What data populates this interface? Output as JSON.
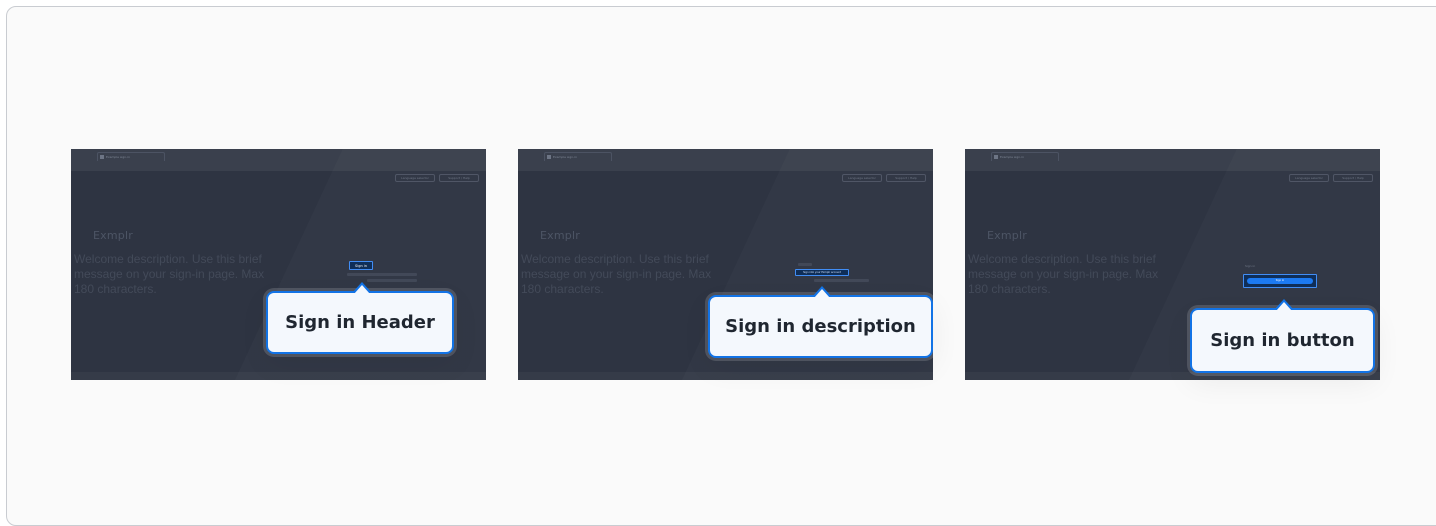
{
  "browser": {
    "tab_title": "Example sign-in"
  },
  "page": {
    "top_buttons": [
      "Language selector",
      "Support / Help"
    ],
    "logo_text": "Exmplr",
    "welcome_text": "Welcome description. Use this brief message on your sign-in page. Max 180 characters."
  },
  "panels": [
    {
      "highlight_text": "Sign in",
      "callout_label": "Sign in Header"
    },
    {
      "highlight_text": "Sign into your Exmplr account",
      "callout_label": "Sign in description"
    },
    {
      "small_label": "Sign in",
      "highlight_text": "Sign in",
      "callout_label": "Sign in button"
    }
  ],
  "colors": {
    "accent": "#1273e6",
    "panel_bg": "#2e3442",
    "callout_bg": "#f4f8fd"
  }
}
